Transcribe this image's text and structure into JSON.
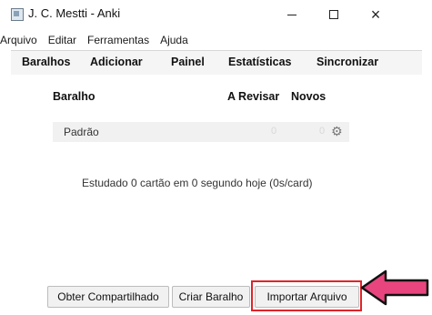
{
  "window": {
    "title": "J. C. Mestti - Anki",
    "controls": {
      "minimize": "–",
      "maximize": "☐",
      "close": "×"
    }
  },
  "menu": {
    "items": [
      "Arquivo",
      "Editar",
      "Ferramentas",
      "Ajuda"
    ]
  },
  "toolbar": {
    "items": [
      "Baralhos",
      "Adicionar",
      "Painel",
      "Estatísticas",
      "Sincronizar"
    ]
  },
  "deck_table": {
    "headers": {
      "name": "Baralho",
      "due": "A Revisar",
      "new": "Novos"
    },
    "rows": [
      {
        "name": "Padrão",
        "due": "0",
        "new": "0"
      }
    ]
  },
  "studied_text": "Estudado 0 cartão em 0 segundo hoje (0s/card)",
  "buttons": {
    "shared": "Obter Compartilhado",
    "create": "Criar Baralho",
    "import": "Importar Arquivo"
  },
  "colors": {
    "highlight": "#e0242a",
    "arrow": "#e8457e"
  },
  "icons": [
    "anki-app-icon",
    "gear-icon",
    "pointer-arrow"
  ]
}
